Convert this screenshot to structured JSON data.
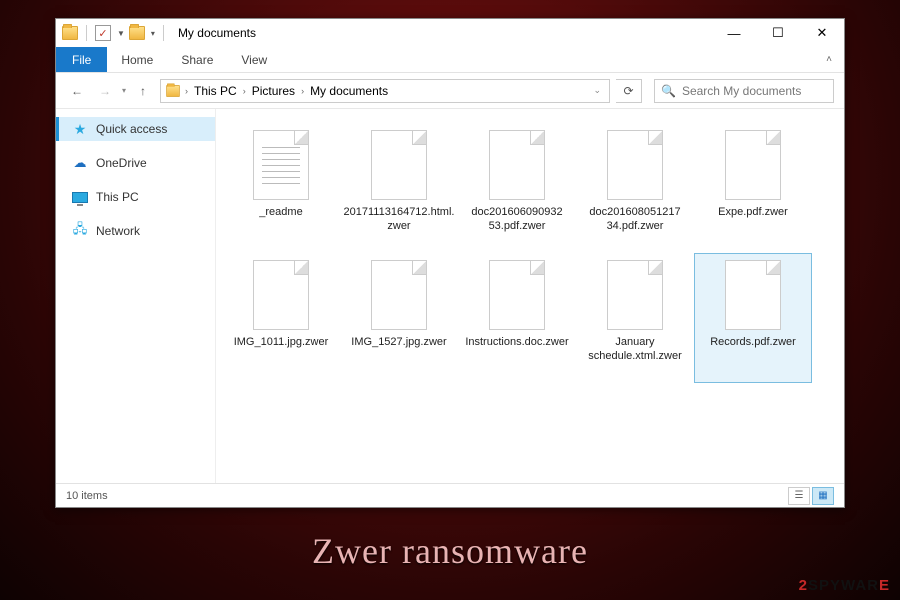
{
  "window": {
    "title": "My documents",
    "controls": {
      "min": "—",
      "max": "☐",
      "close": "✕"
    }
  },
  "ribbon": {
    "file": "File",
    "tabs": [
      "Home",
      "Share",
      "View"
    ]
  },
  "nav": {
    "back": "←",
    "forward": "→",
    "up": "↑",
    "refresh": "⟳",
    "breadcrumb": [
      "This PC",
      "Pictures",
      "My documents"
    ],
    "search_placeholder": "Search My documents"
  },
  "sidebar": {
    "items": [
      {
        "label": "Quick access",
        "icon": "star",
        "selected": true
      },
      {
        "label": "OneDrive",
        "icon": "cloud",
        "selected": false
      },
      {
        "label": "This PC",
        "icon": "pc",
        "selected": false
      },
      {
        "label": "Network",
        "icon": "net",
        "selected": false
      }
    ]
  },
  "files": [
    {
      "name": "_readme",
      "type": "text",
      "selected": false
    },
    {
      "name": "20171113164712.html.zwer",
      "type": "blank",
      "selected": false
    },
    {
      "name": "doc201606090932 53.pdf.zwer",
      "type": "blank",
      "selected": false
    },
    {
      "name": "doc201608051217 34.pdf.zwer",
      "type": "blank",
      "selected": false
    },
    {
      "name": "Expe.pdf.zwer",
      "type": "blank",
      "selected": false
    },
    {
      "name": "IMG_1011.jpg.zwer",
      "type": "blank",
      "selected": false
    },
    {
      "name": "IMG_1527.jpg.zwer",
      "type": "blank",
      "selected": false
    },
    {
      "name": "Instructions.doc.zwer",
      "type": "blank",
      "selected": false
    },
    {
      "name": "January schedule.xtml.zwer",
      "type": "blank",
      "selected": false
    },
    {
      "name": "Records.pdf.zwer",
      "type": "blank",
      "selected": true
    }
  ],
  "status": {
    "count_label": "10 items"
  },
  "caption": "Zwer ransomware",
  "watermark": {
    "two": "2",
    "spy": "SPYWAR",
    "e": "E"
  }
}
